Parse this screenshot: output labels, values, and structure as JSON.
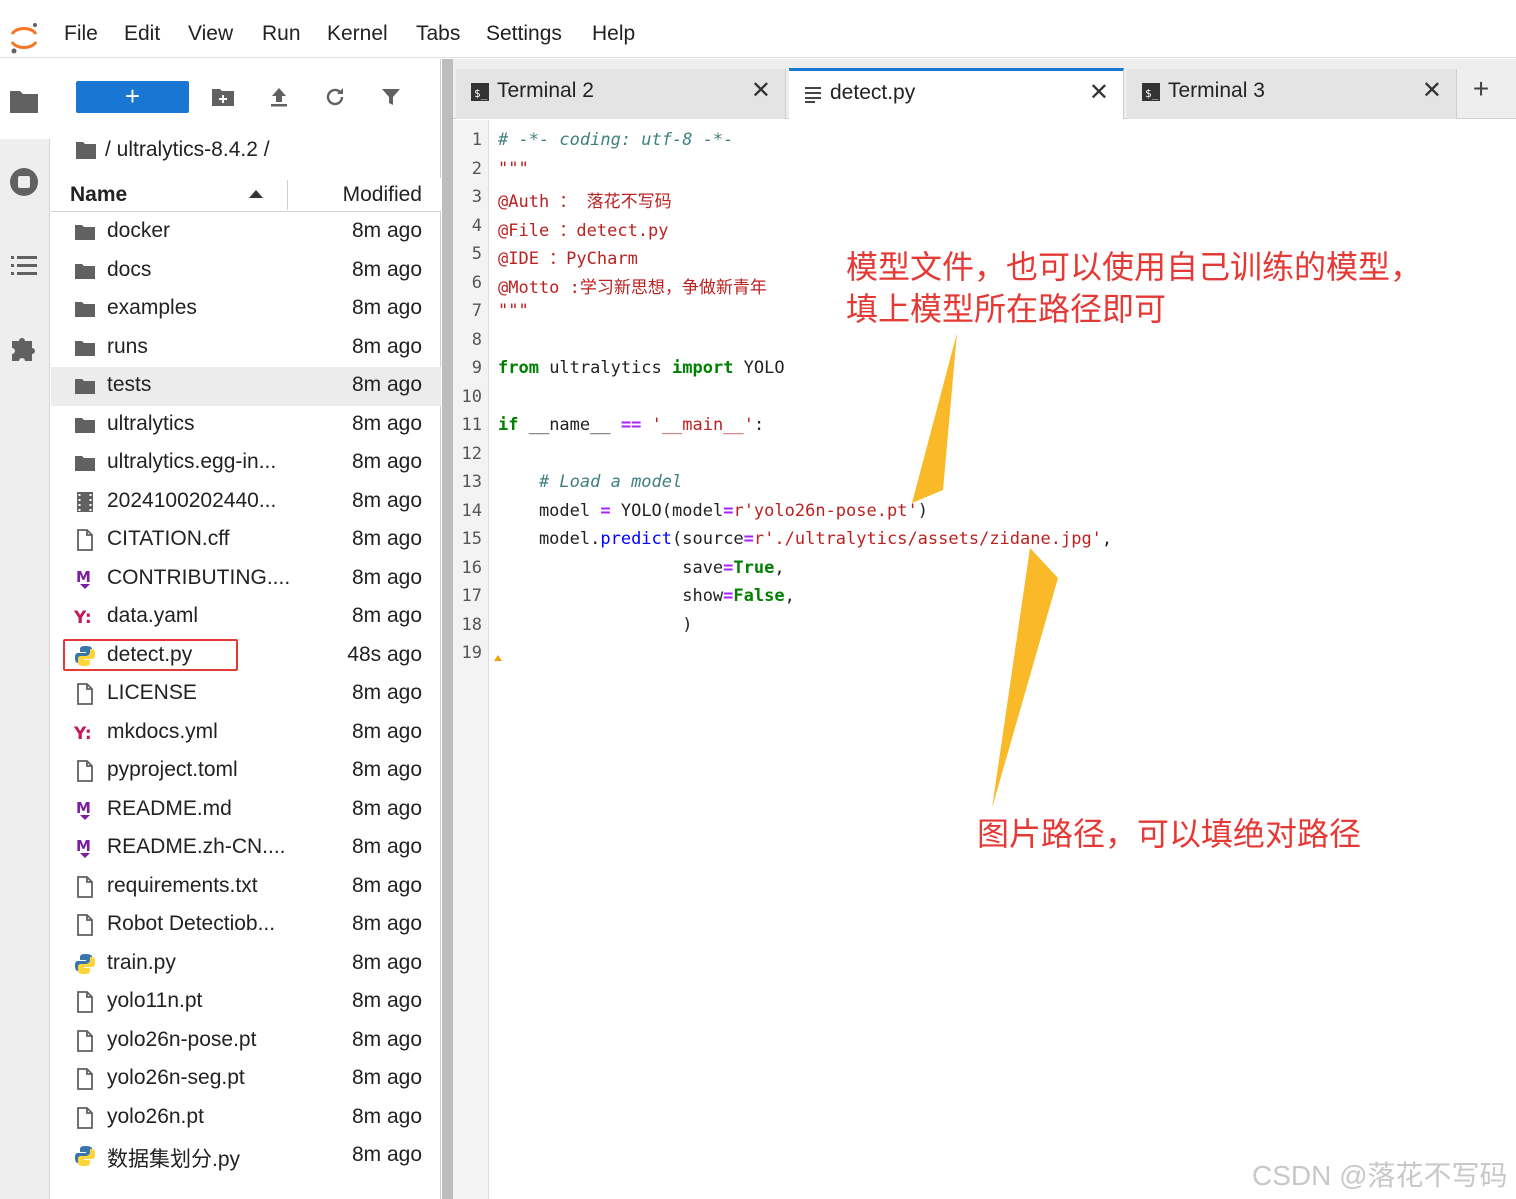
{
  "menu": [
    "File",
    "Edit",
    "View",
    "Run",
    "Kernel",
    "Tabs",
    "Settings",
    "Help"
  ],
  "filebrowser": {
    "new_button": "+",
    "breadcrumb": "/ ultralytics-8.4.2 /",
    "col_name": "Name",
    "col_modified": "Modified",
    "files": [
      {
        "name": "docker",
        "modified": "8m ago",
        "icon": "folder-icon"
      },
      {
        "name": "docs",
        "modified": "8m ago",
        "icon": "folder-icon"
      },
      {
        "name": "examples",
        "modified": "8m ago",
        "icon": "folder-icon"
      },
      {
        "name": "runs",
        "modified": "8m ago",
        "icon": "folder-icon"
      },
      {
        "name": "tests",
        "modified": "8m ago",
        "icon": "folder-icon"
      },
      {
        "name": "ultralytics",
        "modified": "8m ago",
        "icon": "folder-icon"
      },
      {
        "name": "ultralytics.egg-in...",
        "modified": "8m ago",
        "icon": "folder-icon"
      },
      {
        "name": "2024100202440...",
        "modified": "8m ago",
        "icon": "video-icon"
      },
      {
        "name": "CITATION.cff",
        "modified": "8m ago",
        "icon": "file-icon"
      },
      {
        "name": "CONTRIBUTING....",
        "modified": "8m ago",
        "icon": "markdown-icon"
      },
      {
        "name": "data.yaml",
        "modified": "8m ago",
        "icon": "yaml-icon"
      },
      {
        "name": "detect.py",
        "modified": "48s ago",
        "icon": "python-icon"
      },
      {
        "name": "LICENSE",
        "modified": "8m ago",
        "icon": "file-icon"
      },
      {
        "name": "mkdocs.yml",
        "modified": "8m ago",
        "icon": "yaml-icon"
      },
      {
        "name": "pyproject.toml",
        "modified": "8m ago",
        "icon": "file-icon"
      },
      {
        "name": "README.md",
        "modified": "8m ago",
        "icon": "markdown-icon"
      },
      {
        "name": "README.zh-CN....",
        "modified": "8m ago",
        "icon": "markdown-icon"
      },
      {
        "name": "requirements.txt",
        "modified": "8m ago",
        "icon": "file-icon"
      },
      {
        "name": "Robot Detectiob...",
        "modified": "8m ago",
        "icon": "file-icon"
      },
      {
        "name": "train.py",
        "modified": "8m ago",
        "icon": "python-icon"
      },
      {
        "name": "yolo11n.pt",
        "modified": "8m ago",
        "icon": "file-icon"
      },
      {
        "name": "yolo26n-pose.pt",
        "modified": "8m ago",
        "icon": "file-icon"
      },
      {
        "name": "yolo26n-seg.pt",
        "modified": "8m ago",
        "icon": "file-icon"
      },
      {
        "name": "yolo26n.pt",
        "modified": "8m ago",
        "icon": "file-icon"
      },
      {
        "name": "数据集划分.py",
        "modified": "8m ago",
        "icon": "python-icon"
      }
    ]
  },
  "tabs": [
    {
      "label": "Terminal 2",
      "icon": "terminal-icon",
      "active": false
    },
    {
      "label": "detect.py",
      "icon": "text-file-icon",
      "active": true
    },
    {
      "label": "Terminal 3",
      "icon": "terminal-icon",
      "active": false
    }
  ],
  "tab_close": "✕",
  "new_tab": "+",
  "editor": {
    "line_numbers": [
      "1",
      "2",
      "3",
      "4",
      "5",
      "6",
      "7",
      "8",
      "9",
      "10",
      "11",
      "12",
      "13",
      "14",
      "15",
      "16",
      "17",
      "18",
      "19"
    ],
    "lines": [
      [
        {
          "t": "# -*- coding: utf-8 -*-",
          "c": "comment"
        }
      ],
      [
        {
          "t": "\"\"\"",
          "c": "str"
        }
      ],
      [
        {
          "t": "@Auth ： 落花不写码",
          "c": "str"
        }
      ],
      [
        {
          "t": "@File ：detect.py",
          "c": "str"
        }
      ],
      [
        {
          "t": "@IDE ：PyCharm",
          "c": "str"
        }
      ],
      [
        {
          "t": "@Motto :学习新思想，争做新青年",
          "c": "str"
        }
      ],
      [
        {
          "t": "\"\"\"",
          "c": "str"
        }
      ],
      [],
      [
        {
          "t": "from",
          "c": "kw"
        },
        {
          "t": " ultralytics ",
          "c": "plain"
        },
        {
          "t": "import",
          "c": "kw"
        },
        {
          "t": " YOLO",
          "c": "plain"
        }
      ],
      [],
      [
        {
          "t": "if",
          "c": "kw"
        },
        {
          "t": " __name__ ",
          "c": "plain"
        },
        {
          "t": "==",
          "c": "op"
        },
        {
          "t": " ",
          "c": "plain"
        },
        {
          "t": "'__main__'",
          "c": "str"
        },
        {
          "t": ":",
          "c": "plain"
        }
      ],
      [],
      [
        {
          "t": "    ",
          "c": "plain"
        },
        {
          "t": "# Load a model",
          "c": "comment"
        }
      ],
      [
        {
          "t": "    model ",
          "c": "plain"
        },
        {
          "t": "=",
          "c": "op"
        },
        {
          "t": " YOLO(model",
          "c": "plain"
        },
        {
          "t": "=",
          "c": "op"
        },
        {
          "t": "r'yolo26n-pose.pt'",
          "c": "str"
        },
        {
          "t": ")",
          "c": "plain"
        }
      ],
      [
        {
          "t": "    model.",
          "c": "plain"
        },
        {
          "t": "predict",
          "c": "fn"
        },
        {
          "t": "(source",
          "c": "plain"
        },
        {
          "t": "=",
          "c": "op"
        },
        {
          "t": "r'./ultralytics/assets/zidane.jpg'",
          "c": "str"
        },
        {
          "t": ",",
          "c": "plain"
        }
      ],
      [
        {
          "t": "                  save",
          "c": "plain"
        },
        {
          "t": "=",
          "c": "op"
        },
        {
          "t": "True",
          "c": "kw"
        },
        {
          "t": ",",
          "c": "plain"
        }
      ],
      [
        {
          "t": "                  show",
          "c": "plain"
        },
        {
          "t": "=",
          "c": "op"
        },
        {
          "t": "False",
          "c": "kw"
        },
        {
          "t": ",",
          "c": "plain"
        }
      ],
      [
        {
          "t": "                  )",
          "c": "plain"
        }
      ],
      []
    ]
  },
  "annotations": {
    "model_note_line1": "模型文件，也可以使用自己训练的模型，",
    "model_note_line2": "填上模型所在路径即可",
    "image_note": "图片路径，可以填绝对路径"
  },
  "watermark": "CSDN @落花不写码",
  "colors": {
    "accent": "#1976d2",
    "annotation": "#e53935",
    "arrow": "#f9b928"
  }
}
